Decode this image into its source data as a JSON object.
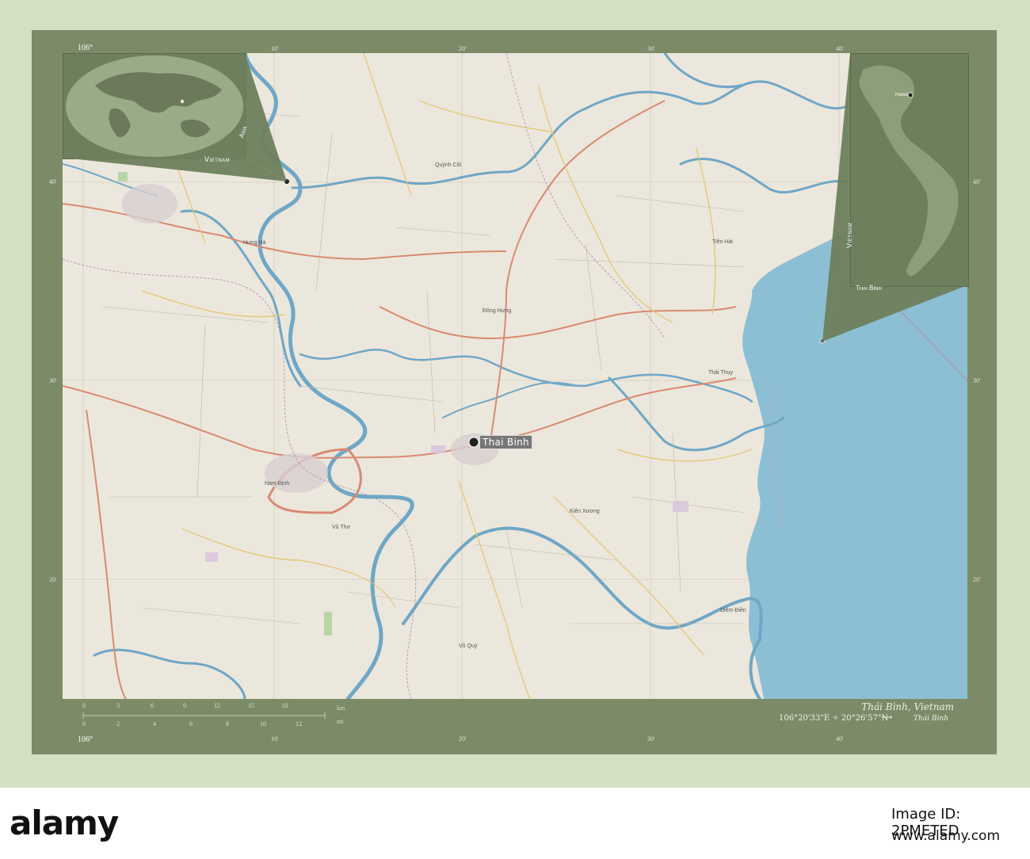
{
  "map": {
    "main_label": "Thai Binh",
    "place_labels": [
      "Hưng Hà",
      "Quỳnh Côi",
      "Tiền Hải",
      "Kiến Xương",
      "Vũ Thư",
      "Đông Hưng",
      "Thái Thụy",
      "Nam Định",
      "Vũ Quý",
      "Diêm Điền"
    ]
  },
  "ticks": {
    "top": [
      "106°",
      "10'",
      "20'",
      "30'",
      "40'"
    ],
    "bottom": [
      "106°",
      "10'",
      "20'",
      "30'",
      "40'"
    ],
    "left": [
      "40'",
      "30'",
      "20'"
    ],
    "right": [
      "40'",
      "30'",
      "20'"
    ]
  },
  "inset_world": {
    "country_label": "Vietnam",
    "region_label": "Asia"
  },
  "inset_country": {
    "country_label": "Vietnam",
    "region_label": "Thai Binh",
    "capital_label": "Hanoi"
  },
  "scale": {
    "km_ticks": [
      "0",
      "3",
      "6",
      "9",
      "12",
      "15",
      "18"
    ],
    "km_unit": "km",
    "mi_ticks": [
      "0",
      "2",
      "4",
      "6",
      "8",
      "10",
      "12"
    ],
    "mi_unit": "mi"
  },
  "footer": {
    "title": "Thái Bình, Vietnam",
    "coordinates": "106°20'33\"E ✧ 20°26'57\"N",
    "arrow": "⟶",
    "region": "Thái Bình"
  },
  "watermark": {
    "logo": "alamy",
    "image_id": "Image ID: 2PMETED",
    "url": "www.alamy.com"
  },
  "colors": {
    "background": "#d4e0c4",
    "frame": "#7b8b68",
    "sea": "#8cbfd4",
    "river": "#6fa7c6",
    "land": "#ece7dc"
  }
}
